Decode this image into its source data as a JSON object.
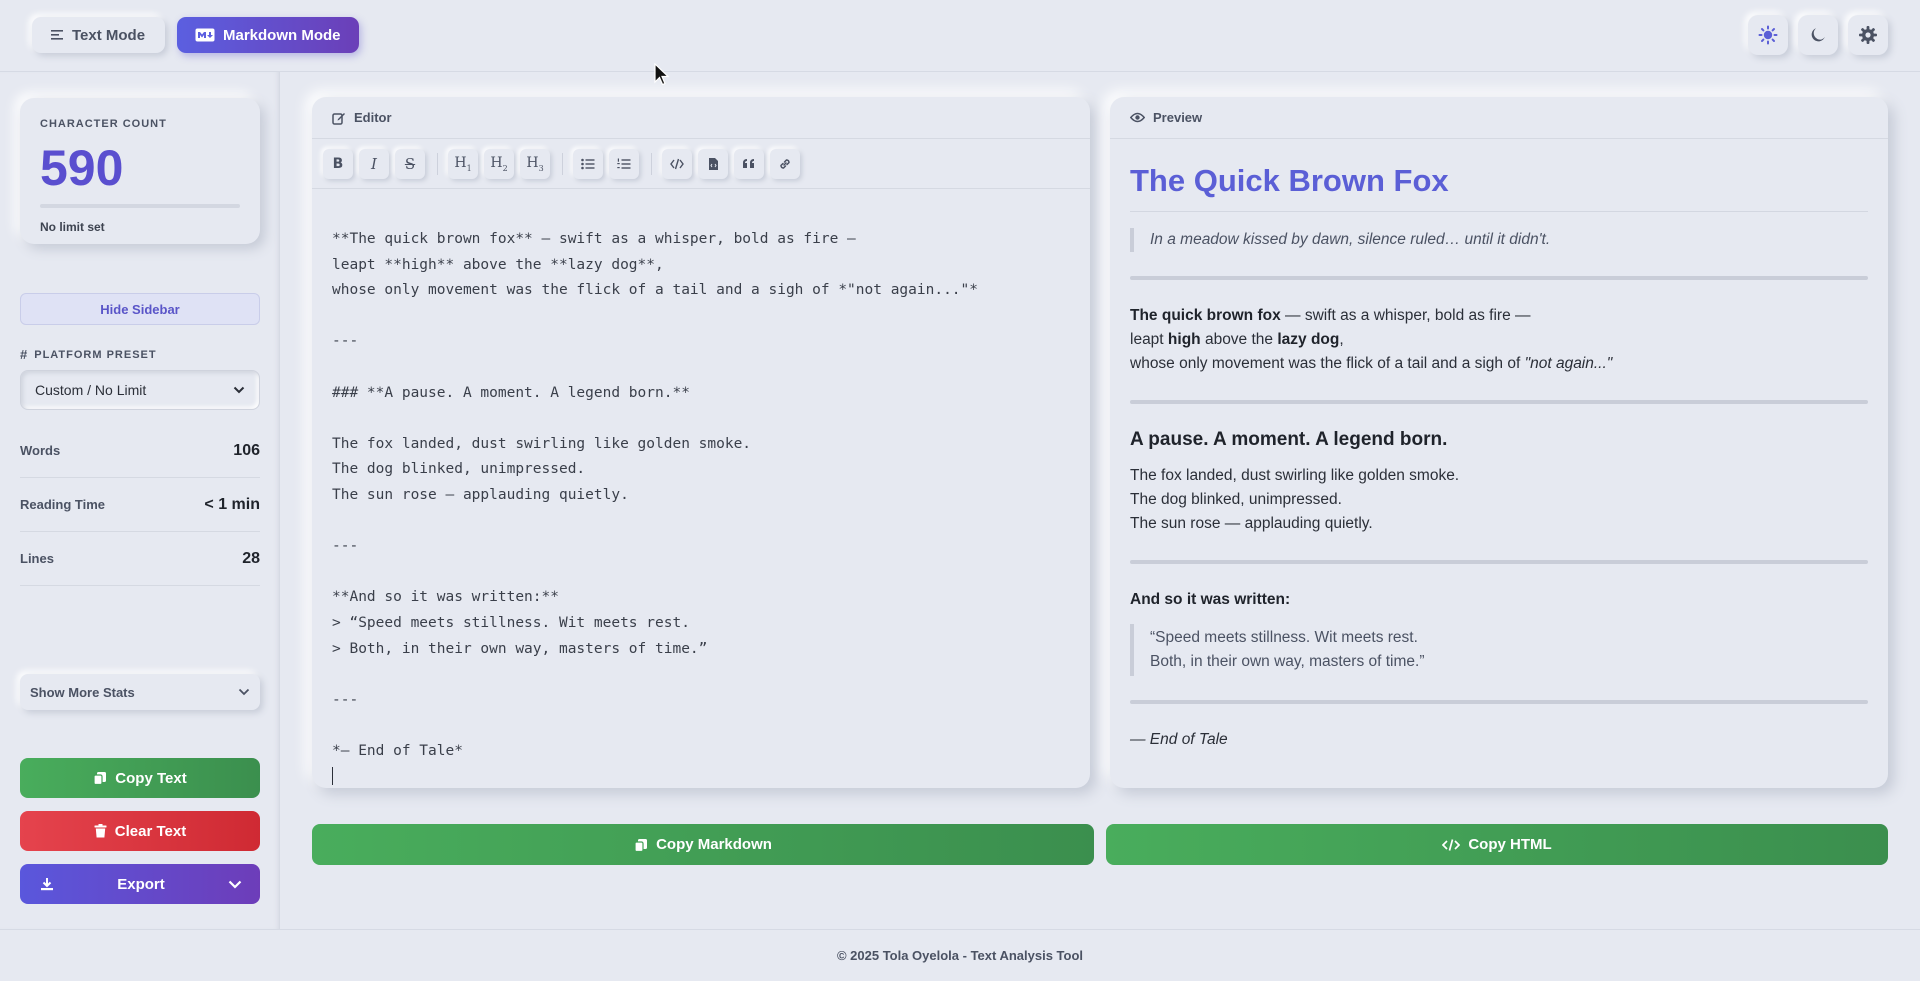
{
  "modes": {
    "text_label": "Text Mode",
    "markdown_label": "Markdown Mode"
  },
  "sidebar": {
    "count_label": "CHARACTER COUNT",
    "count_value": "590",
    "limit_note": "No limit set",
    "hide_label": "Hide Sidebar",
    "preset_label": "PLATFORM PRESET",
    "preset_value": "Custom / No Limit",
    "stats": [
      {
        "name": "Words",
        "value": "106"
      },
      {
        "name": "Reading Time",
        "value": "< 1 min"
      },
      {
        "name": "Lines",
        "value": "28"
      }
    ],
    "more_stats_label": "Show More Stats",
    "copy_label": "Copy Text",
    "clear_label": "Clear Text",
    "export_label": "Export"
  },
  "editor": {
    "title": "Editor",
    "content": "**The quick brown fox** — swift as a whisper, bold as fire —\nleapt **high** above the **lazy dog**,\nwhose only movement was the flick of a tail and a sigh of *\"not again...\"*\n\n---\n\n### **A pause. A moment. A legend born.**\n\nThe fox landed, dust swirling like golden smoke.\nThe dog blinked, unimpressed.\nThe sun rose — applauding quietly.\n\n---\n\n**And so it was written:**\n> “Speed meets stillness. Wit meets rest.\n> Both, in their own way, masters of time.”\n\n---\n\n*— End of Tale*\n"
  },
  "preview": {
    "title": "Preview",
    "h1": "The Quick Brown Fox",
    "intro_quote": "In a meadow kissed by dawn, silence ruled… until it didn't.",
    "p1": {
      "fox": "The quick brown fox",
      "line1_rest": " — swift as a whisper, bold as fire —",
      "leapt": "leapt ",
      "high": "high",
      "above": " above the ",
      "lazy_dog": "lazy dog",
      "comma": ",",
      "line3": "whose only movement was the flick of a tail and a sigh of ",
      "not_again": "\"not again...\""
    },
    "h3": "A pause. A moment. A legend born.",
    "p2_lines": [
      "The fox landed, dust swirling like golden smoke.",
      "The dog blinked, unimpressed.",
      "The sun rose — applauding quietly."
    ],
    "written": "And so it was written:",
    "quote_lines": [
      "“Speed meets stillness. Wit meets rest.",
      "Both, in their own way, masters of time.”"
    ],
    "end": "— End of Tale"
  },
  "actions": {
    "copy_markdown": "Copy Markdown",
    "copy_html": "Copy HTML"
  },
  "footer": {
    "text": "© 2025 Tola Oyelola - Text Analysis Tool"
  },
  "colors": {
    "accent": "#5b5fd6",
    "success": "#49ad5c",
    "danger": "#e5434d",
    "bg": "#e6e9f1"
  }
}
